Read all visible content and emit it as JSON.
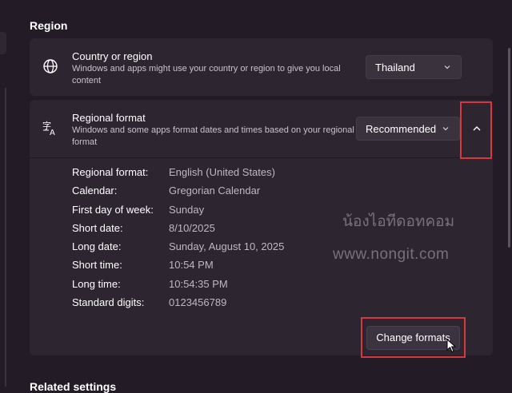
{
  "section": {
    "title": "Region"
  },
  "country": {
    "title": "Country or region",
    "description": "Windows and apps might use your country or region to give you local content",
    "selected": "Thailand",
    "icon": "globe-icon"
  },
  "regional_format": {
    "title": "Regional format",
    "description": "Windows and some apps format dates and times based on your regional format",
    "selected": "Recommended",
    "icon": "language-format-icon",
    "expanded": true,
    "details": [
      {
        "label": "Regional format:",
        "value": "English (United States)"
      },
      {
        "label": "Calendar:",
        "value": "Gregorian Calendar"
      },
      {
        "label": "First day of week:",
        "value": "Sunday"
      },
      {
        "label": "Short date:",
        "value": "8/10/2025"
      },
      {
        "label": "Long date:",
        "value": "Sunday, August 10, 2025"
      },
      {
        "label": "Short time:",
        "value": "10:54 PM"
      },
      {
        "label": "Long time:",
        "value": "10:54:35 PM"
      },
      {
        "label": "Standard digits:",
        "value": "0123456789"
      }
    ],
    "change_button": "Change formats"
  },
  "watermark": {
    "thai": "น้องไอทีดอทคอม",
    "url": "www.nongit.com"
  },
  "related": {
    "title": "Related settings"
  },
  "colors": {
    "highlight": "#d7383e",
    "background": "#231c26",
    "card": "#2d2631"
  }
}
